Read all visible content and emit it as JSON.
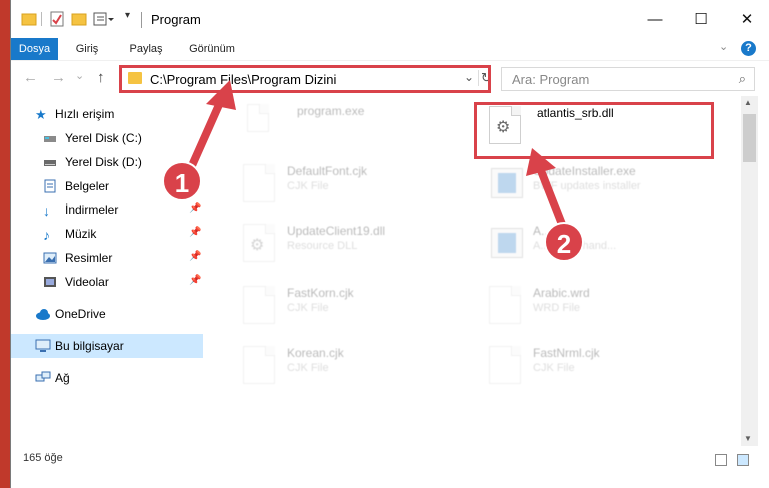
{
  "window": {
    "title": "Program",
    "controls": {
      "minimize": "—",
      "maximize": "☐",
      "close": "✕"
    }
  },
  "ribbon": {
    "tabs": [
      "Dosya",
      "Giriş",
      "Paylaş",
      "Görünüm"
    ],
    "help": "?"
  },
  "nav": {
    "back": "←",
    "forward": "→",
    "recent": "⌄",
    "up": "↑",
    "address": "C:\\Program Files\\Program Dizini",
    "search_placeholder": "Ara: Program"
  },
  "sidebar": {
    "quick_access": "Hızlı erişim",
    "items": [
      {
        "label": "Yerel Disk (C:)",
        "icon": "drive-icon"
      },
      {
        "label": "Yerel Disk (D:)",
        "icon": "drive-icon"
      },
      {
        "label": "Belgeler",
        "icon": "documents-icon"
      },
      {
        "label": "İndirmeler",
        "icon": "downloads-icon"
      },
      {
        "label": "Müzik",
        "icon": "music-icon"
      },
      {
        "label": "Resimler",
        "icon": "pictures-icon"
      },
      {
        "label": "Videolar",
        "icon": "videos-icon"
      }
    ],
    "onedrive": "OneDrive",
    "this_pc": "Bu bilgisayar",
    "network": "Ağ"
  },
  "files": {
    "program_exe": {
      "name": "program.exe",
      "type": ""
    },
    "dll": {
      "name": "atlantis_srb.dll",
      "type": ""
    },
    "defaultfont": {
      "name": "DefaultFont.cjk",
      "type": "CJK File"
    },
    "updateinstaller": {
      "name": "UpdateInstaller.exe",
      "type": "BWF updates installer"
    },
    "updateclient": {
      "name": "UpdateClient19.dll",
      "type": "Resource DLL"
    },
    "launcher": {
      "name": "A...l.exe",
      "type": "A... event hand..."
    },
    "fastkorn": {
      "name": "FastKorn.cjk",
      "type": "CJK File"
    },
    "arabic": {
      "name": "Arabic.wrd",
      "type": "WRD File"
    },
    "korean": {
      "name": "Korean.cjk",
      "type": "CJK File"
    },
    "fastnrml": {
      "name": "FastNrml.cjk",
      "type": "CJK File"
    }
  },
  "status": {
    "item_count": "165 öğe"
  },
  "annotations": {
    "step1": "1",
    "step2": "2",
    "accent": "#d9424a"
  }
}
